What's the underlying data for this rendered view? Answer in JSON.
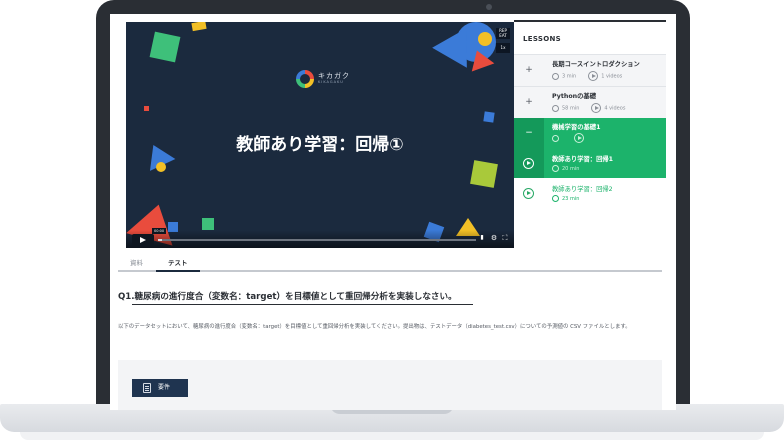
{
  "video": {
    "logo_text": "キカガク",
    "logo_subtext": "KIKAGAKU",
    "slide_title": "教師あり学習：回帰①",
    "side_badge_top": "REP EAT",
    "side_badge_bottom": "1x",
    "time_tooltip": "00:00"
  },
  "lessons": {
    "header": "LESSONS",
    "chapters": [
      {
        "title": "長期コースイントロダクション",
        "duration": "3 min",
        "videos": "1 videos",
        "icon": "+"
      },
      {
        "title": "Pythonの基礎",
        "duration": "58 min",
        "videos": "4 videos",
        "icon": "+"
      },
      {
        "title": "機械学習の基礎1",
        "duration": "",
        "videos": "",
        "icon": "−"
      }
    ],
    "subitems": [
      {
        "title": "教師あり学習：回帰1",
        "duration": "20 min"
      },
      {
        "title": "教師あり学習：回帰2",
        "duration": "23 min"
      }
    ]
  },
  "tabs": [
    {
      "label": "資料"
    },
    {
      "label": "テスト"
    }
  ],
  "question": {
    "title": "Q1.糖尿病の進行度合（変数名：target）を目標値として重回帰分析を実装しなさい。",
    "description": "以下のデータセットにおいて、糖尿病の進行度合（変数名：target）を目標値として重回帰分析を実装してください。提出物は、テストデータ（diabetes_test.csv）についての予測値の CSV ファイルとします。",
    "requirements_button": "要件"
  },
  "colors": {
    "accent_green": "#1cb36b",
    "video_bg": "#1b2a3e",
    "navy_button": "#1f3450"
  }
}
